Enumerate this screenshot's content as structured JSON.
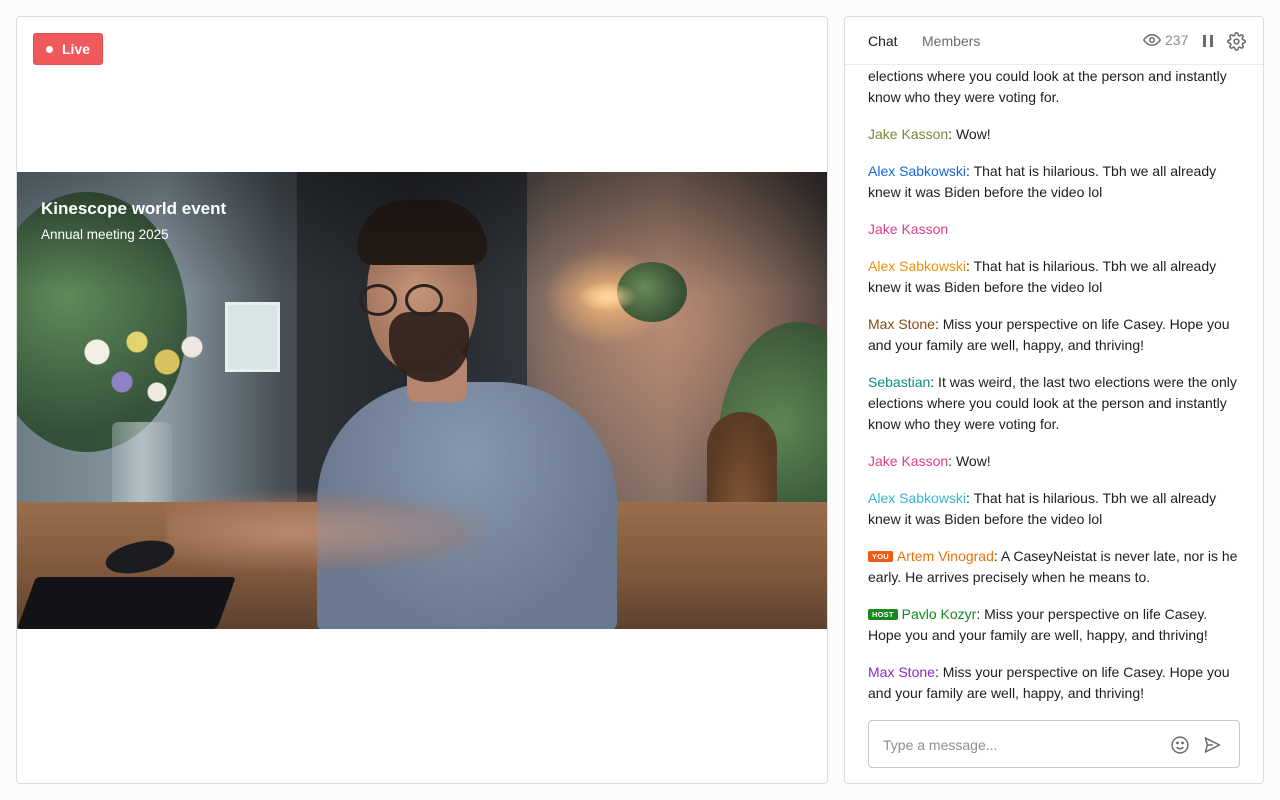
{
  "player": {
    "live_label": "Live",
    "video_title": "Kinescope world event",
    "video_subtitle": "Annual meeting 2025"
  },
  "chat": {
    "tabs": [
      {
        "label": "Chat",
        "active": true
      },
      {
        "label": "Members",
        "active": false
      }
    ],
    "viewer_count": "237",
    "header_icons": [
      "eye-icon",
      "pause-icon",
      "gear-icon"
    ],
    "messages": [
      {
        "author": "",
        "color": "#1d1d1f",
        "text": "elections where you could look at the person and instantly know who they were voting for."
      },
      {
        "author": "Jake Kasson",
        "color": "#7d8540",
        "text": ": Wow!"
      },
      {
        "author": "Alex Sabkowski",
        "color": "#1565d8",
        "text": ": That hat is hilarious. Tbh we all already knew it was Biden before the video lol"
      },
      {
        "author": "Jake Kasson",
        "color": "#e0408a",
        "text": ""
      },
      {
        "author": "Alex Sabkowski",
        "color": "#f0900c",
        "text": ": That hat is hilarious. Tbh we all already knew it was Biden before the video lol"
      },
      {
        "author": "Max Stone",
        "color": "#8b4a0c",
        "text": ": Miss your perspective on life Casey.  Hope you and your family are well, happy, and thriving!"
      },
      {
        "author": "Sebastian",
        "color": "#0f8a86",
        "text": ": It was weird, the last two elections were the only elections where you could look at the person and instantly know who they were voting for."
      },
      {
        "author": "Jake Kasson",
        "color": "#e0408a",
        "text": ": Wow!"
      },
      {
        "author": "Alex Sabkowski",
        "color": "#35b8d4",
        "text": ": That hat is hilarious. Tbh we all already knew it was Biden before the video lol"
      },
      {
        "author": "Artem Vinograd",
        "color": "#f0700c",
        "badge": "YOU",
        "badge_color": "#f05a12",
        "text": ": A CaseyNeistat is never late, nor is he early. He arrives precisely when he means to."
      },
      {
        "author": "Pavlo Kozyr",
        "color": "#178a1e",
        "badge": "HOST",
        "badge_color": "#178a1e",
        "text": ": Miss your perspective on life Casey. Hope you and your family are well, happy, and thriving!"
      },
      {
        "author": "Max Stone",
        "color": "#8a2cc4",
        "text": ": Miss your perspective on life Casey.  Hope you and your family are well, happy, and thriving!"
      }
    ],
    "composer": {
      "placeholder": "Type a message...",
      "value": ""
    }
  }
}
